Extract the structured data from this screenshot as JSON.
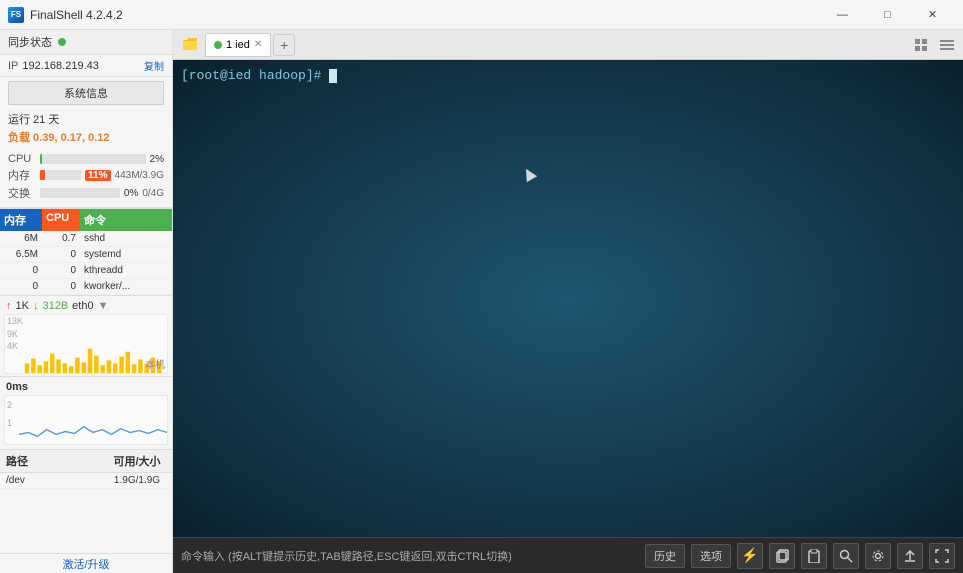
{
  "titlebar": {
    "app_icon": "F",
    "title": "FinalShell 4.2.4.2",
    "minimize": "—",
    "maximize": "□",
    "close": "✕"
  },
  "sidebar": {
    "sync_label": "同步状态",
    "ip_label": "IP",
    "ip_value": "192.168.219.43",
    "copy_label": "复制",
    "sysinfo_label": "系统信息",
    "uptime_label": "运行 21 天",
    "load_label": "负载 0.39, 0.17, 0.12",
    "cpu_label": "CPU",
    "cpu_val": "2%",
    "mem_label": "内存",
    "mem_pct": "11%",
    "mem_val": "443M/3.9G",
    "swap_label": "交换",
    "swap_pct": "0%",
    "swap_val": "0/4G",
    "proc_header": {
      "mem": "内存",
      "cpu": "CPU",
      "cmd": "命令"
    },
    "processes": [
      {
        "mem": "6M",
        "cpu": "0.7",
        "cmd": "sshd"
      },
      {
        "mem": "6.5M",
        "cpu": "0",
        "cmd": "systemd"
      },
      {
        "mem": "0",
        "cpu": "0",
        "cmd": "kthreadd"
      },
      {
        "mem": "0",
        "cpu": "0",
        "cmd": "kworker/..."
      }
    ],
    "net_header": {
      "up_val": "1K",
      "down_val": "312B",
      "iface": "eth0"
    },
    "net_chart_labels": [
      "13K",
      "9K",
      "4K"
    ],
    "net_chart_local": "本机",
    "ping_header": "0ms",
    "ping_chart_labels": [
      "2",
      "1"
    ],
    "disk_header": {
      "path": "路径",
      "avail": "可用/大小"
    },
    "disks": [
      {
        "path": "/dev",
        "avail": "1.9G/1.9G"
      }
    ],
    "activation_label": "激活/升级"
  },
  "tabs": {
    "items": [
      {
        "label": "1 ied",
        "active": true
      }
    ],
    "add_label": "+",
    "grid_icon": "⊞",
    "menu_icon": "≡"
  },
  "terminal": {
    "prompt": "[root@ied hadoop]#"
  },
  "cmdbar": {
    "hint": "命令输入 (按ALT键提示历史,TAB键路径,ESC键返回,双击CTRL切换)",
    "history_btn": "历史",
    "options_btn": "选项",
    "lightning_icon": "⚡",
    "copy_icon": "⎘",
    "paste_icon": "📋",
    "search_icon": "🔍",
    "gear_icon": "⚙",
    "up_icon": "↑",
    "fullscreen_icon": "⛶"
  }
}
